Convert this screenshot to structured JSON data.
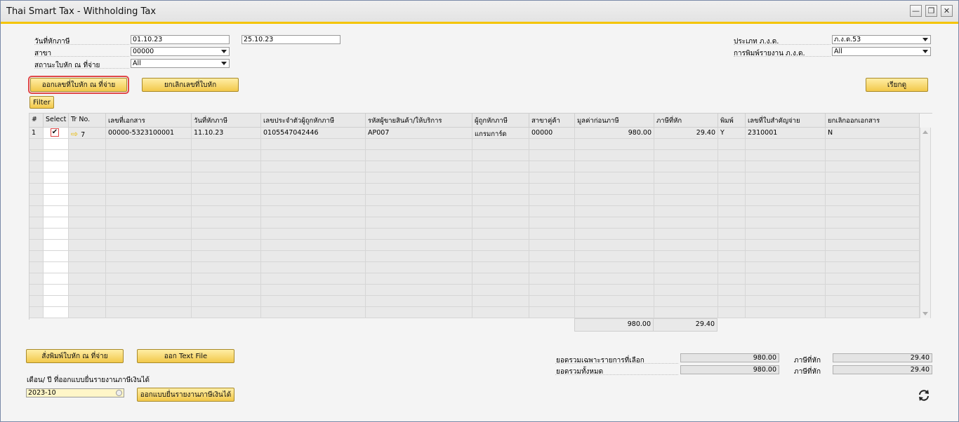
{
  "window": {
    "title": "Thai Smart Tax - Withholding Tax"
  },
  "filters": {
    "wht_date_label": "วันที่หักภาษี",
    "date_from": "01.10.23",
    "date_to": "25.10.23",
    "branch_label": "สาขา",
    "branch_value": "00000",
    "cert_status_label": "สถานะใบหัก ณ ที่จ่าย",
    "cert_status_value": "All",
    "pnd_type_label": "ประเภท ภ.ง.ด.",
    "pnd_type_value": "ภ.ง.ด.53",
    "report_print_label": "การพิมพ์รายงาน ภ.ง.ด.",
    "report_print_value": "All"
  },
  "buttons": {
    "issue_cert": "ออกเลขที่ใบหัก ณ ที่จ่าย",
    "cancel_cert": "ยกเลิกเลขที่ใบหัก",
    "view": "เรียกดู",
    "filter": "Filter",
    "print_cert": "สั่งพิมพ์ใบหัก ณ ที่จ่าย",
    "export_text": "ออก Text File",
    "issue_form": "ออกแบบยื่นรายงานภาษีเงินได้"
  },
  "table": {
    "columns": [
      "#",
      "Select",
      "Tr No.",
      "เลขที่เอกสาร",
      "วันที่หักภาษี",
      "เลขประจำตัวผู้ถูกหักภาษี",
      "รหัสผู้ขายสินค้า/ให้บริการ",
      "ผู้ถูกหักภาษี",
      "สาขาคู่ค้า",
      "มูลค่าก่อนภาษี",
      "ภาษีที่หัก",
      "พิมพ์",
      "เลขที่ใบสำคัญจ่าย",
      "ยกเลิกออกเอกสาร"
    ],
    "rows": [
      {
        "num": "1",
        "selected": true,
        "tr_no": "7",
        "doc_no": "00000-5323100001",
        "wht_date": "11.10.23",
        "tax_id": "0105547042446",
        "vendor_code": "AP007",
        "payee": "แกรมการ์ด",
        "branch": "00000",
        "amount_before_tax": "980.00",
        "wht": "29.40",
        "printed": "Y",
        "payment_voucher": "2310001",
        "cancel_doc": "N"
      }
    ],
    "totals": {
      "amount_before_tax": "980.00",
      "wht": "29.40"
    }
  },
  "summary": {
    "selected_total_label": "ยอดรวมเฉพาะรายการที่เลือก",
    "selected_total_value": "980.00",
    "selected_wht_label": "ภาษีที่หัก",
    "selected_wht_value": "29.40",
    "all_total_label": "ยอดรวมทั้งหมด",
    "all_total_value": "980.00",
    "all_wht_label": "ภาษีที่หัก",
    "all_wht_value": "29.40"
  },
  "period": {
    "label": "เดือน/ ปี ที่ออกแบบยื่นรายงานภาษีเงินได้",
    "value": "2023-10"
  },
  "icons": {
    "link_arrow": "arrow-right-icon",
    "refresh": "refresh-icon"
  },
  "colors": {
    "accent_yellow": "#f4c400",
    "button_fill": "#f2c84a",
    "selection_outline": "#e04848"
  }
}
